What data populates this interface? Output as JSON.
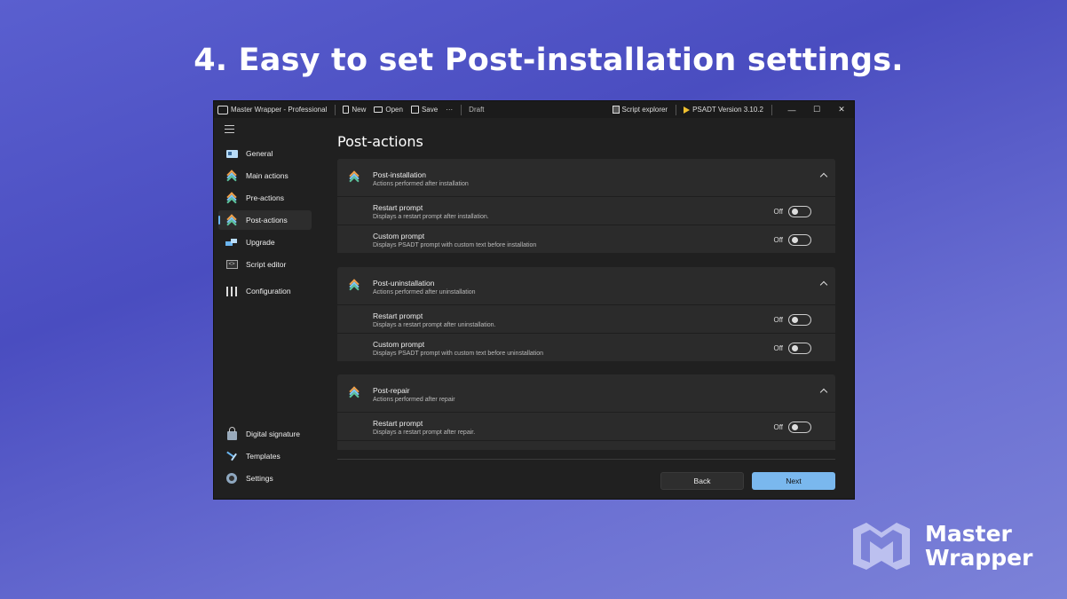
{
  "headline": "4. Easy to set Post-installation settings.",
  "titlebar": {
    "app_title": "Master Wrapper - Professional",
    "new_label": "New",
    "open_label": "Open",
    "save_label": "Save",
    "more_label": "···",
    "status": "Draft",
    "script_explorer_label": "Script explorer",
    "psadt_version_label": "PSADT Version  3.10.2",
    "minimize": "—",
    "maximize": "☐",
    "close": "✕"
  },
  "sidebar": {
    "items": [
      {
        "label": "General",
        "icon": "general-card-icon"
      },
      {
        "label": "Main actions",
        "icon": "chevron-stack-icon"
      },
      {
        "label": "Pre-actions",
        "icon": "chevron-stack-icon"
      },
      {
        "label": "Post-actions",
        "icon": "chevron-stack-icon",
        "active": true
      },
      {
        "label": "Upgrade",
        "icon": "upgrade-icon"
      },
      {
        "label": "Script editor",
        "icon": "script-editor-icon"
      },
      {
        "label": "Configuration",
        "icon": "sliders-icon"
      }
    ],
    "bottom_items": [
      {
        "label": "Digital signature",
        "icon": "lock-icon"
      },
      {
        "label": "Templates",
        "icon": "templates-icon"
      },
      {
        "label": "Settings",
        "icon": "gear-icon"
      }
    ]
  },
  "main": {
    "title": "Post-actions",
    "groups": [
      {
        "title": "Post-installation",
        "subtitle": "Actions performed after installation",
        "rows": [
          {
            "title": "Restart prompt",
            "subtitle": "Displays a restart prompt after installation.",
            "state": "Off"
          },
          {
            "title": "Custom prompt",
            "subtitle": "Displays PSADT prompt with custom text before installation",
            "state": "Off"
          }
        ]
      },
      {
        "title": "Post-uninstallation",
        "subtitle": "Actions performed after uninstallation",
        "rows": [
          {
            "title": "Restart prompt",
            "subtitle": "Displays a restart prompt after uninstallation.",
            "state": "Off"
          },
          {
            "title": "Custom prompt",
            "subtitle": "Displays PSADT prompt with custom text before uninstallation",
            "state": "Off"
          }
        ]
      },
      {
        "title": "Post-repair",
        "subtitle": "Actions performed after repair",
        "rows": [
          {
            "title": "Restart prompt",
            "subtitle": "Displays a restart prompt after repair.",
            "state": "Off"
          }
        ]
      }
    ],
    "back_label": "Back",
    "next_label": "Next"
  },
  "brand": {
    "line1": "Master",
    "line2": "Wrapper"
  }
}
